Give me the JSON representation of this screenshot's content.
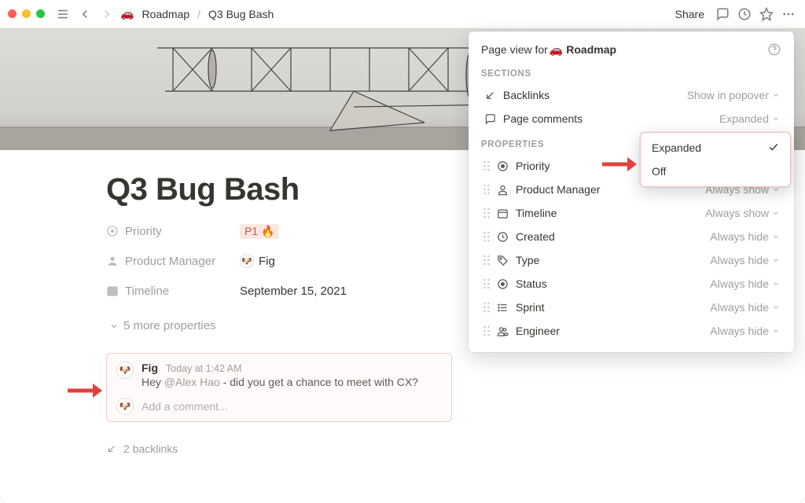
{
  "breadcrumb": {
    "icon": "🚗",
    "parent": "Roadmap",
    "current": "Q3 Bug Bash"
  },
  "toolbar": {
    "share": "Share"
  },
  "page": {
    "title": "Q3 Bug Bash",
    "properties": {
      "priority_label": "Priority",
      "priority_value": "P1 🔥",
      "pm_label": "Product Manager",
      "pm_value": "Fig",
      "timeline_label": "Timeline",
      "timeline_value": "September 15, 2021",
      "more": "5 more properties"
    },
    "backlinks": "2 backlinks"
  },
  "comment": {
    "author": "Fig",
    "time": "Today at 1:42 AM",
    "text_prefix": "Hey ",
    "mention": "@Alex Hao",
    "text_suffix": " - did you get a chance to meet with CX?",
    "placeholder": "Add a comment..."
  },
  "panel": {
    "title_prefix": "Page view for ",
    "title_icon": "🚗",
    "title_bold": "Roadmap",
    "sections_label": "SECTIONS",
    "properties_label": "PROPERTIES",
    "sections": [
      {
        "icon": "backlink",
        "label": "Backlinks",
        "value": "Show in popover"
      },
      {
        "icon": "comment",
        "label": "Page comments",
        "value": "Expanded"
      }
    ],
    "props": [
      {
        "icon": "target",
        "label": "Priority",
        "value": ""
      },
      {
        "icon": "person",
        "label": "Product Manager",
        "value": "Always show"
      },
      {
        "icon": "calendar",
        "label": "Timeline",
        "value": "Always show"
      },
      {
        "icon": "clock",
        "label": "Created",
        "value": "Always hide"
      },
      {
        "icon": "tag",
        "label": "Type",
        "value": "Always hide"
      },
      {
        "icon": "status",
        "label": "Status",
        "value": "Always hide"
      },
      {
        "icon": "list",
        "label": "Sprint",
        "value": "Always hide"
      },
      {
        "icon": "people",
        "label": "Engineer",
        "value": "Always hide"
      }
    ]
  },
  "dropdown": {
    "options": [
      {
        "label": "Expanded",
        "checked": true
      },
      {
        "label": "Off",
        "checked": false
      }
    ]
  }
}
